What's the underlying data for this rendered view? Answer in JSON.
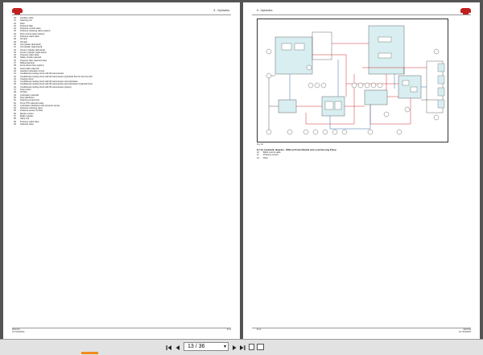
{
  "viewer": {
    "page_indicator": "13 / 36",
    "colors": {
      "background": "#545454",
      "toolbar": "#e2e2e2",
      "brand_red": "#c0201e",
      "diagram_red": "#d03030",
      "diagram_blue": "#3a6ea8",
      "highlight_teal": "#d8eef0"
    }
  },
  "left_page": {
    "header_right": "8 - Hydraulics",
    "legend": [
      {
        "n": "20",
        "t": "Auxiliary valve"
      },
      {
        "n": "21",
        "t": "Steering unit"
      },
      {
        "n": "22",
        "t": "Filter"
      },
      {
        "n": "23",
        "t": "Pressure filter"
      },
      {
        "n": "24",
        "t": "Pressure control valve"
      },
      {
        "n": "25",
        "t": "Pressure reducing valve (option)"
      },
      {
        "n": "26",
        "t": "Flow control valve (option)"
      },
      {
        "n": "27",
        "t": "Pressure relief valve"
      },
      {
        "n": "28",
        "t": "Oil tank"
      },
      {
        "n": "29",
        "t": "Oil tank"
      },
      {
        "n": "30",
        "t": "Lift cylinder (left-hand)"
      },
      {
        "n": "31",
        "t": "Lift cylinder (right-hand)"
      },
      {
        "n": "32",
        "t": "Lift arm cylinder (left-hand)"
      },
      {
        "n": "33",
        "t": "Lift arm cylinder (right-hand)"
      },
      {
        "n": "34",
        "t": "Pressure relief valve"
      },
      {
        "n": "35",
        "t": "Safety shuttle solenoid"
      },
      {
        "n": "36",
        "t": "Pressure filter solenoid valve"
      },
      {
        "n": "37",
        "t": "Differential lock"
      },
      {
        "n": "38",
        "t": "Front-wheel drive (option)"
      },
      {
        "n": "39",
        "t": "Gear brake solenoid"
      },
      {
        "n": "40",
        "t": "Gearbox lubrication circuit"
      },
      {
        "n": "41",
        "t": "Conditioned cooling circuit with lift transmission"
      },
      {
        "n": "42",
        "t": "Conditioned cooling circuit with lift transmission (hydraulic flow for the front lift)"
      },
      {
        "n": "43",
        "t": "Cooling circuit"
      },
      {
        "n": "44",
        "t": "Conditioned cooling circuit with lift transmission and lubrication"
      },
      {
        "n": "45",
        "t": "Conditioned cooling circuit with lift transmission and lubrication (hydraulic flow)"
      },
      {
        "n": "46",
        "t": "Conditioned cooling circuit with lift transmission (option)"
      },
      {
        "n": "47",
        "t": "Gear cooler"
      },
      {
        "n": "48",
        "t": "Oil filter"
      },
      {
        "n": "49",
        "t": "Lubrication solenoid"
      },
      {
        "n": "50",
        "t": "Flow distributor"
      },
      {
        "n": "51",
        "t": "Steering pump/motor"
      },
      {
        "n": "52",
        "t": "Front PTO solenoid valve"
      },
      {
        "n": "53",
        "t": "Lubrication distributor with pressure sensor"
      },
      {
        "n": "54",
        "t": "Pressure reducing valve"
      },
      {
        "n": "55",
        "t": "Pressure sensor for filter"
      },
      {
        "n": "56",
        "t": "Master control"
      },
      {
        "n": "57",
        "t": "Brake cylinder"
      },
      {
        "n": "58",
        "t": "Valve unit"
      },
      {
        "n": "59",
        "t": "Pressure relief valve"
      },
      {
        "n": "60",
        "t": "Solenoid valve"
      }
    ],
    "footer_left_1": "MF6700",
    "footer_left_2": "ACT0046840",
    "footer_right": "8-13"
  },
  "right_page": {
    "header_left": "8 - Hydraulics",
    "figure_caption": "Fig. 10",
    "section_title": "8.7.13. Hydraulic diagram - Without PowerShuttle and Load Sensing Pump",
    "legend": [
      {
        "n": "10",
        "t": "Block control valve"
      },
      {
        "n": "11",
        "t": "Pressure sensor"
      },
      {
        "n": "12",
        "t": "Filter"
      }
    ],
    "footer_left": "8-14",
    "footer_right_1": "MF6700",
    "footer_right_2": "ACT0046840"
  }
}
